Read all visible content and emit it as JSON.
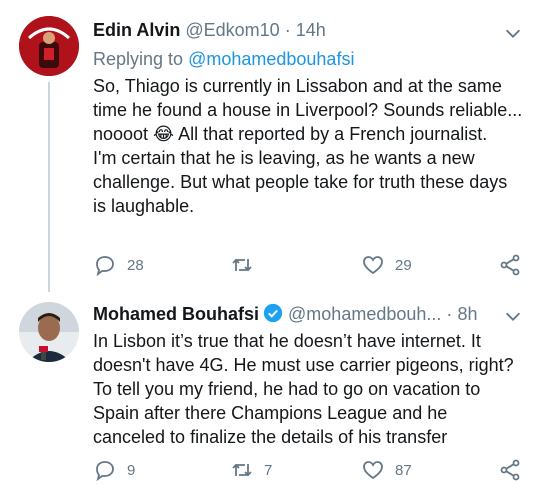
{
  "tweet1": {
    "name": "Edin Alvin",
    "handle": "@Edkom10",
    "separator": "·",
    "time": "14h",
    "reply_prefix": "Replying to",
    "reply_mention": "@mohamedbouhafsi",
    "paragraph1": "So, Thiago is currently in Lissabon and at the same time he found a house in Liverpool? Sounds reliable... noooot 😂 All that reported by a French journalist.",
    "paragraph2": "I'm certain that he is leaving, as he wants a new challenge. But what people take for truth these days is laughable.",
    "replies": "28",
    "retweets": "",
    "likes": "29"
  },
  "tweet2": {
    "name": "Mohamed Bouhafsi",
    "handle": "@mohamedbouh...",
    "separator": "·",
    "time": "8h",
    "text": "In Lisbon it’s true that he doesn’t have internet.  It doesn't have 4G.  He must use carrier pigeons, right? To tell you my friend, he had to go on vacation to Spain after there Champions League and he canceled to finalize the details of his transfer",
    "replies": "9",
    "retweets": "7",
    "likes": "87"
  },
  "colors": {
    "text": "#14171a",
    "secondary": "#657786",
    "link": "#1b95e0",
    "verified": "#1da1f2",
    "avatar1_bg": "#b0121b"
  },
  "icons": [
    "chevron-down-icon",
    "reply-icon",
    "retweet-icon",
    "like-icon",
    "share-icon",
    "verified-icon"
  ]
}
